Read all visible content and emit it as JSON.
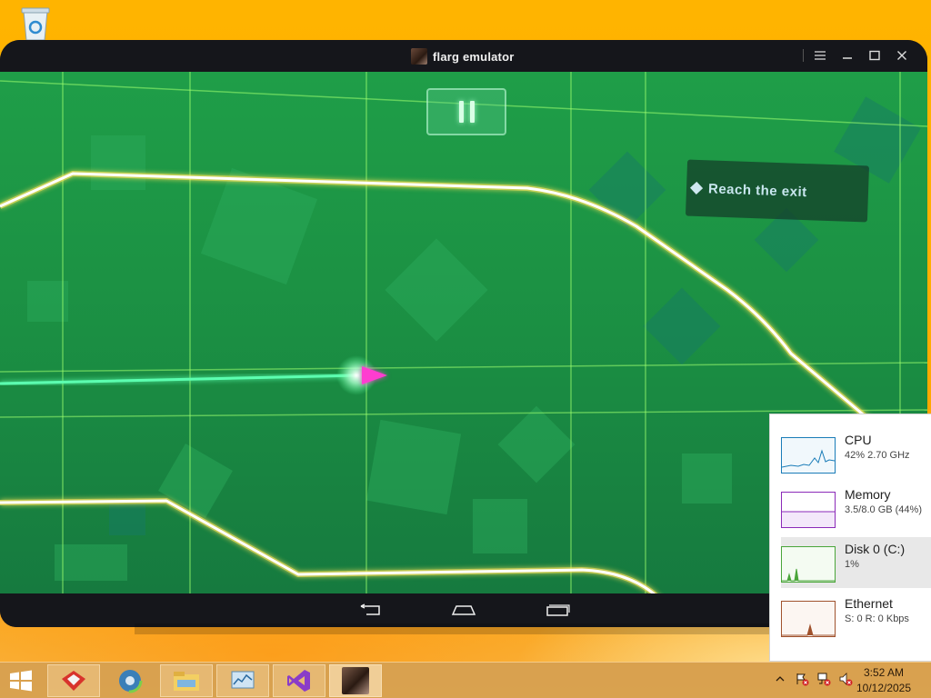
{
  "window": {
    "title": "flarg emulator",
    "controls": [
      "menu-icon",
      "minimize-icon",
      "maximize-icon",
      "close-icon"
    ]
  },
  "game": {
    "pause_icon": "pause-icon",
    "objective": "Reach the exit",
    "colors": {
      "background": "#1b8f43",
      "track": "#ffffff",
      "trail": "#5cffb0",
      "player": "#ff3cd0"
    }
  },
  "android_nav": {
    "buttons": [
      "back-icon",
      "home-icon",
      "recents-icon"
    ]
  },
  "performance": {
    "items": [
      {
        "title": "CPU",
        "sub": "42% 2.70 GHz",
        "color": "#1a7cb8"
      },
      {
        "title": "Memory",
        "sub": "3.5/8.0 GB (44%)",
        "color": "#8b2ab8"
      },
      {
        "title": "Disk 0 (C:)",
        "sub": "1%",
        "color": "#4aa53a"
      },
      {
        "title": "Ethernet",
        "sub": "S: 0 R: 0 Kbps",
        "color": "#a0522d"
      }
    ]
  },
  "taskbar": {
    "apps": [
      "start-icon",
      "toolbox-icon",
      "browser-icon",
      "file-explorer-icon",
      "resource-monitor-icon",
      "visual-studio-icon",
      "emulator-app-icon"
    ],
    "tray": [
      "show-hidden-icons",
      "flag-alert-icon",
      "network-alert-icon",
      "volume-muted-icon"
    ],
    "time": "3:52 AM",
    "date": "10/12/2025"
  }
}
